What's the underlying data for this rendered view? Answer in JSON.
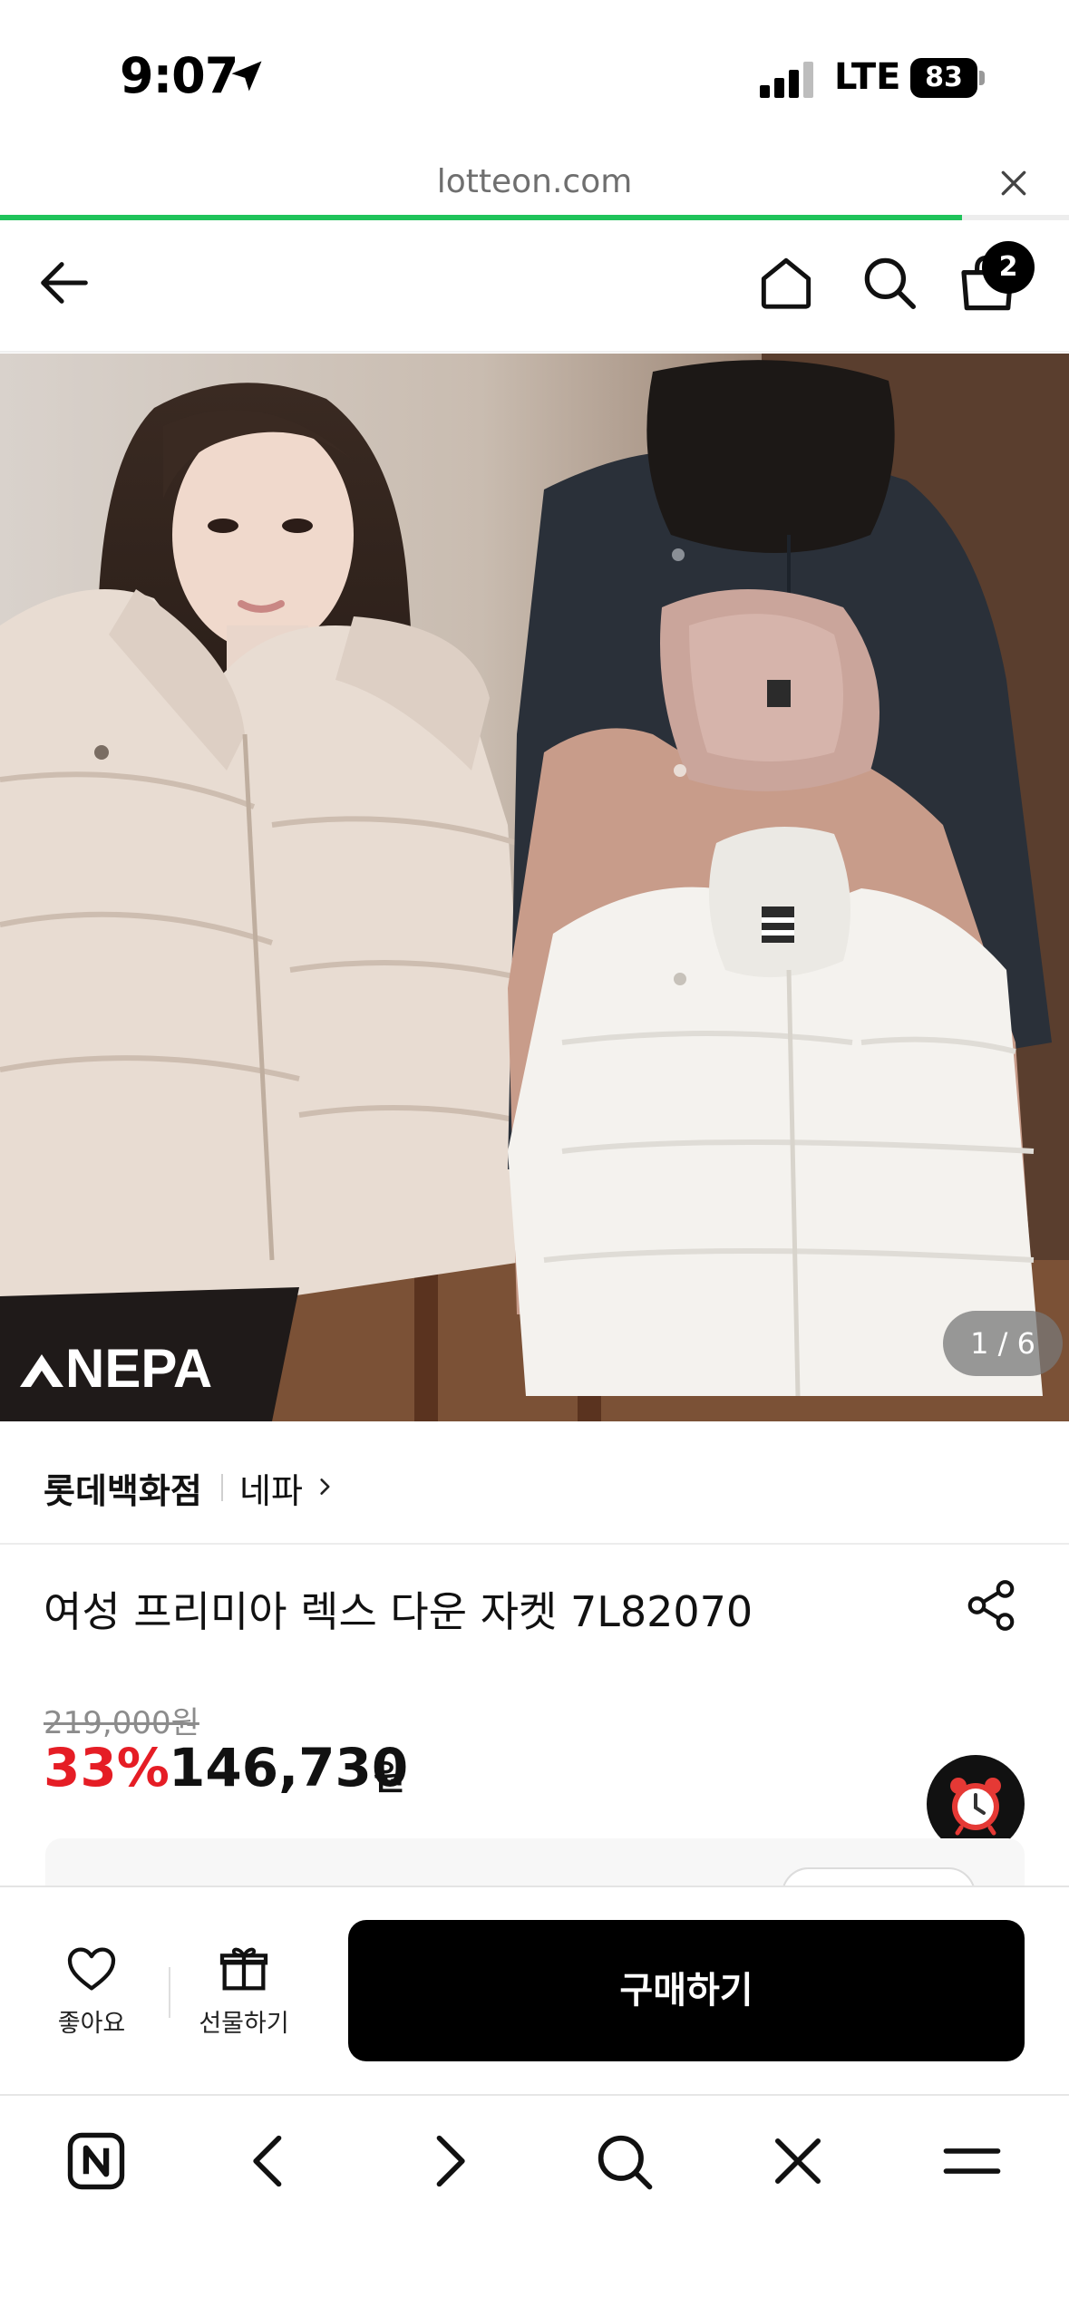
{
  "status_bar": {
    "time": "9:07",
    "network": "LTE",
    "battery": "83",
    "icons": [
      "location-arrow-icon",
      "signal-icon",
      "battery-icon"
    ]
  },
  "url_bar": {
    "url": "lotteon.com",
    "load_progress": 0.9,
    "progress_color": "#1fc35a"
  },
  "header": {
    "icons": [
      "back-arrow-icon",
      "home-icon",
      "search-icon",
      "shopping-bag-icon"
    ],
    "cart_count": "2"
  },
  "gallery": {
    "logo_text": "NEPA",
    "counter": "1 / 6"
  },
  "brand": {
    "store": "롯데백화점",
    "brand_name": "네파"
  },
  "product": {
    "title": "여성 프리미아 렉스 다운 자켓 7L82070",
    "original_price": "219,000원",
    "discount": "33%",
    "sale_price": "146,730",
    "currency": "원"
  },
  "purchase_bar": {
    "like_label": "좋아요",
    "gift_label": "선물하기",
    "buy_label": "구매하기"
  },
  "browser_toolbar": {
    "icons": [
      "naver-n-icon",
      "chevron-left-icon",
      "chevron-right-icon",
      "search-icon",
      "close-icon",
      "menu-icon"
    ]
  },
  "colors": {
    "discount_red": "#e51d25",
    "buy_button": "#000000"
  }
}
